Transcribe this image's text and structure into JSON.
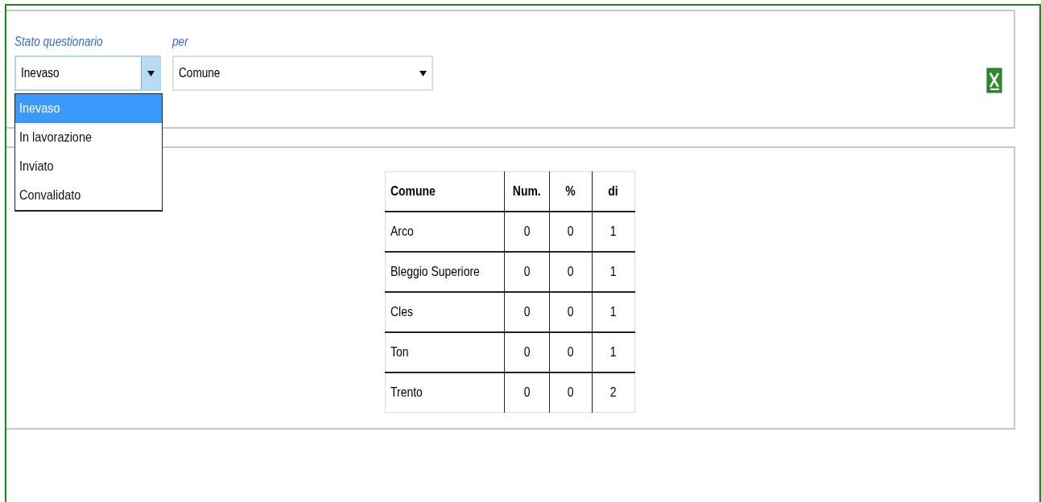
{
  "filters": [
    {
      "label": "Stato questionario",
      "value": "Inevaso",
      "focused": true
    },
    {
      "label": "per",
      "value": "Comune",
      "focused": false
    }
  ],
  "dropdown": {
    "options": [
      {
        "label": "Inevaso",
        "selected": true
      },
      {
        "label": "In lavorazione",
        "selected": false
      },
      {
        "label": "Inviato",
        "selected": false
      },
      {
        "label": "Convalidato",
        "selected": false
      }
    ]
  },
  "table": {
    "columns": [
      "Comune",
      "Num.",
      "%",
      "di"
    ],
    "rows": [
      [
        "Arco",
        "0",
        "0",
        "1"
      ],
      [
        "Bleggio Superiore",
        "0",
        "0",
        "1"
      ],
      [
        "Cles",
        "0",
        "0",
        "1"
      ],
      [
        "Ton",
        "0",
        "0",
        "1"
      ],
      [
        "Trento",
        "0",
        "0",
        "2"
      ]
    ]
  }
}
